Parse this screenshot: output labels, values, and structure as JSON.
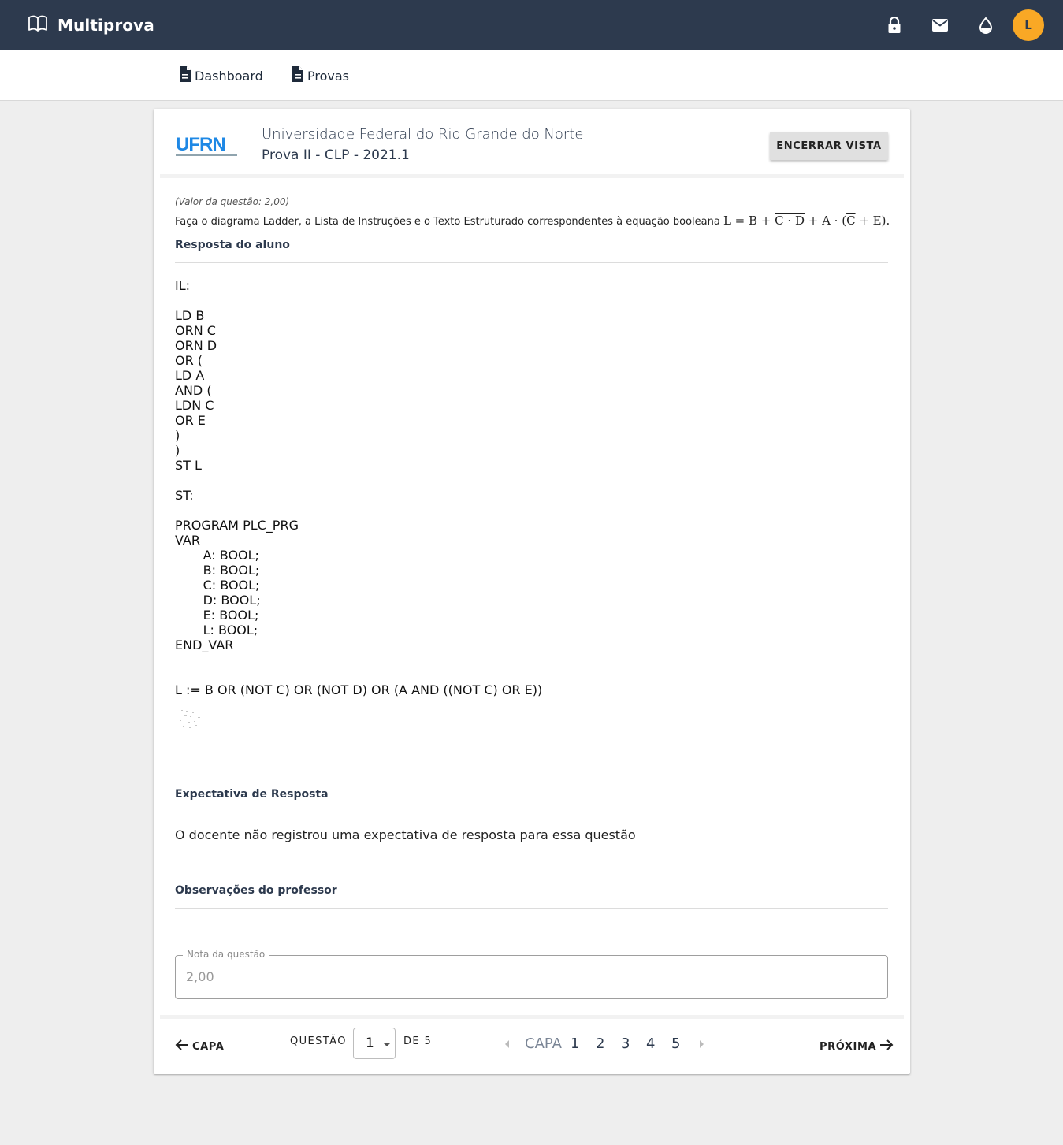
{
  "app": {
    "title": "Multiprova",
    "avatar_initial": "L",
    "bar_color": "#2d3a4e",
    "avatar_color": "#f9a825"
  },
  "nav": {
    "items": [
      {
        "label": "Dashboard",
        "icon": "document-icon"
      },
      {
        "label": "Provas",
        "icon": "document-icon"
      }
    ]
  },
  "header": {
    "logo_text": "UFRN",
    "university": "Universidade Federal do Rio Grande do Norte",
    "exam": "Prova II - CLP - 2021.1",
    "close_button": "ENCERRAR VISTA"
  },
  "question": {
    "value": "(Valor da questão: 2,00)",
    "statement": "Faça o diagrama Ladder, a Lista de Instruções e o Texto Estruturado correspondentes à equação booleana ",
    "equation": {
      "part1": "L = B + ",
      "overlined": "C · D",
      "part2": " + A · (",
      "overlined2": "C",
      "part3": " + E)."
    }
  },
  "answer": {
    "title": "Resposta do aluno",
    "text": "IL:\n\nLD B\nORN C\nORN D\nOR (\nLD A\nAND (\nLDN C\nOR E\n)\n)\nST L\n\nST:\n\nPROGRAM PLC_PRG\nVAR\n       A: BOOL;\n       B: BOOL;\n       C: BOOL;\n       D: BOOL;\n       E: BOOL;\n       L: BOOL;\nEND_VAR\n\n\nL := B OR (NOT C) OR (NOT D) OR (A AND ((NOT C) OR E))"
  },
  "expectation": {
    "title": "Expectativa de Resposta",
    "text": "O docente não registrou uma expectativa de resposta para essa questão"
  },
  "observations": {
    "title": "Observações do professor"
  },
  "grade": {
    "label": "Nota da questão",
    "value": "2,00"
  },
  "footer": {
    "prev_label": "CAPA",
    "question_label": "QUESTÃO",
    "selected_question": "1",
    "of_label": "DE 5",
    "pager": [
      "CAPA",
      "1",
      "2",
      "3",
      "4",
      "5"
    ],
    "next_label": "PRÓXIMA"
  }
}
